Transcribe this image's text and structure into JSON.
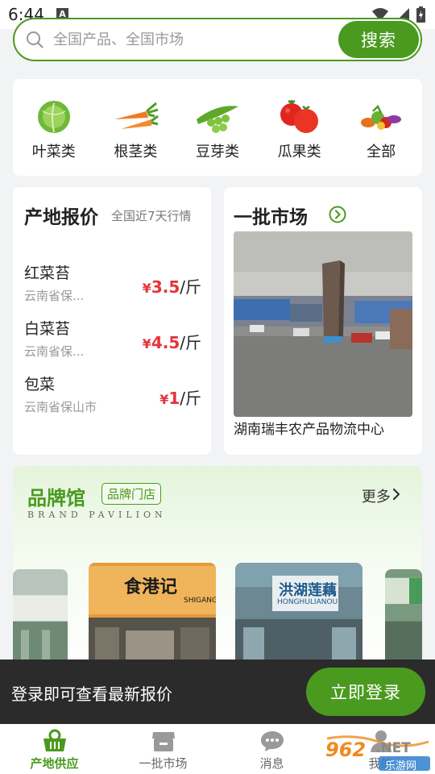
{
  "status_bar": {
    "time": "6:44",
    "notif_letter": "A"
  },
  "search": {
    "placeholder": "全国产品、全国市场",
    "button_label": "搜索"
  },
  "categories": [
    {
      "label": "叶菜类",
      "icon": "cabbage-icon"
    },
    {
      "label": "根茎类",
      "icon": "carrot-icon"
    },
    {
      "label": "豆芽类",
      "icon": "peas-icon"
    },
    {
      "label": "瓜果类",
      "icon": "tomato-icon"
    },
    {
      "label": "全部",
      "icon": "mixed-vegetables-icon"
    }
  ],
  "price_panel": {
    "title": "产地报价",
    "subtitle": "全国近7天行情",
    "items": [
      {
        "name": "红菜苔",
        "origin": "云南省保...",
        "currency": "¥",
        "price": "3.5",
        "unit": "/斤"
      },
      {
        "name": "白菜苔",
        "origin": "云南省保...",
        "currency": "¥",
        "price": "4.5",
        "unit": "/斤"
      },
      {
        "name": "包菜",
        "origin": "云南省保山市",
        "currency": "¥",
        "price": "1",
        "unit": "/斤"
      }
    ]
  },
  "market_panel": {
    "title": "一批市场",
    "market_name": "湖南瑞丰农产品物流中心"
  },
  "brand": {
    "title": "品牌馆",
    "badge": "品牌门店",
    "subtitle_en": "BRAND PAVILION",
    "more_label": "更多",
    "stores": [
      {
        "sign": "食港记",
        "sign_en": "SHIGANGJI"
      },
      {
        "sign": "洪湖莲藕",
        "sign_en": "HONGHULIANOU"
      }
    ]
  },
  "login_prompt": {
    "text": "登录即可查看最新报价",
    "button_label": "立即登录"
  },
  "tabs": [
    {
      "label": "产地供应",
      "active": true
    },
    {
      "label": "一批市场",
      "active": false
    },
    {
      "label": "消息",
      "active": false
    },
    {
      "label": "我的",
      "active": false
    }
  ],
  "watermark": {
    "brand": "962",
    "domain": ".NET",
    "site": "乐游网"
  },
  "colors": {
    "accent": "#4a9a1f",
    "price": "#e5343b",
    "login_bar": "#2b2b2b"
  }
}
